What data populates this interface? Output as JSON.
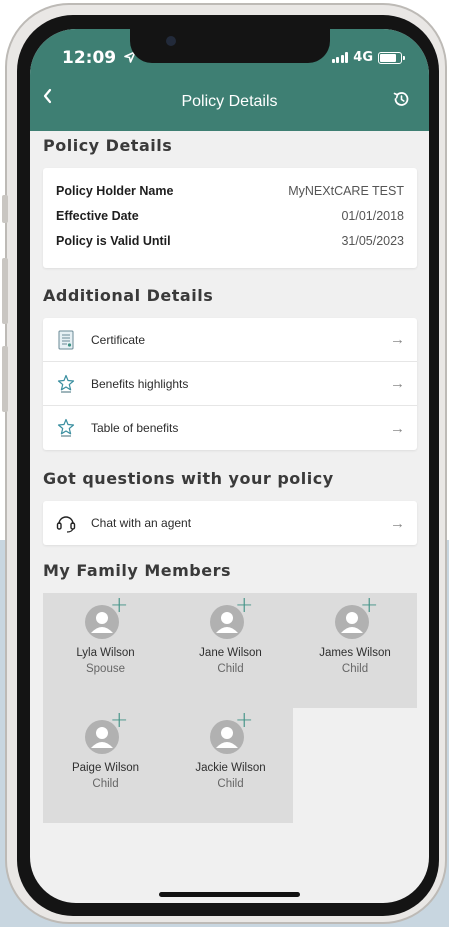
{
  "status_bar": {
    "time": "12:09",
    "network": "4G"
  },
  "nav": {
    "title": "Policy Details",
    "back_icon": "chevron-left-icon",
    "history_icon": "history-icon"
  },
  "policy": {
    "section_title": "Policy Details",
    "rows": [
      {
        "label": "Policy Holder Name",
        "value": "MyNEXtCARE TEST"
      },
      {
        "label": "Effective Date",
        "value": "01/01/2018"
      },
      {
        "label": "Policy is Valid Until",
        "value": "31/05/2023"
      }
    ]
  },
  "additional": {
    "section_title": "Additional Details",
    "items": [
      {
        "label": "Certificate",
        "icon": "document-icon"
      },
      {
        "label": "Benefits highlights",
        "icon": "star-icon"
      },
      {
        "label": "Table of benefits",
        "icon": "star-icon"
      }
    ]
  },
  "questions": {
    "section_title": "Got questions with your policy",
    "items": [
      {
        "label": "Chat with an agent",
        "icon": "headset-icon"
      }
    ]
  },
  "family": {
    "section_title": "My Family Members",
    "members": [
      {
        "name": "Lyla Wilson",
        "role": "Spouse"
      },
      {
        "name": "Jane Wilson",
        "role": "Child"
      },
      {
        "name": "James Wilson",
        "role": "Child"
      },
      {
        "name": "Paige Wilson",
        "role": "Child"
      },
      {
        "name": "Jackie Wilson",
        "role": "Child"
      }
    ]
  },
  "colors": {
    "header": "#3e7f73",
    "accent_plus": "#3e9184",
    "member_bg": "#dcdcdc",
    "page_bg": "#f0f0f0"
  }
}
